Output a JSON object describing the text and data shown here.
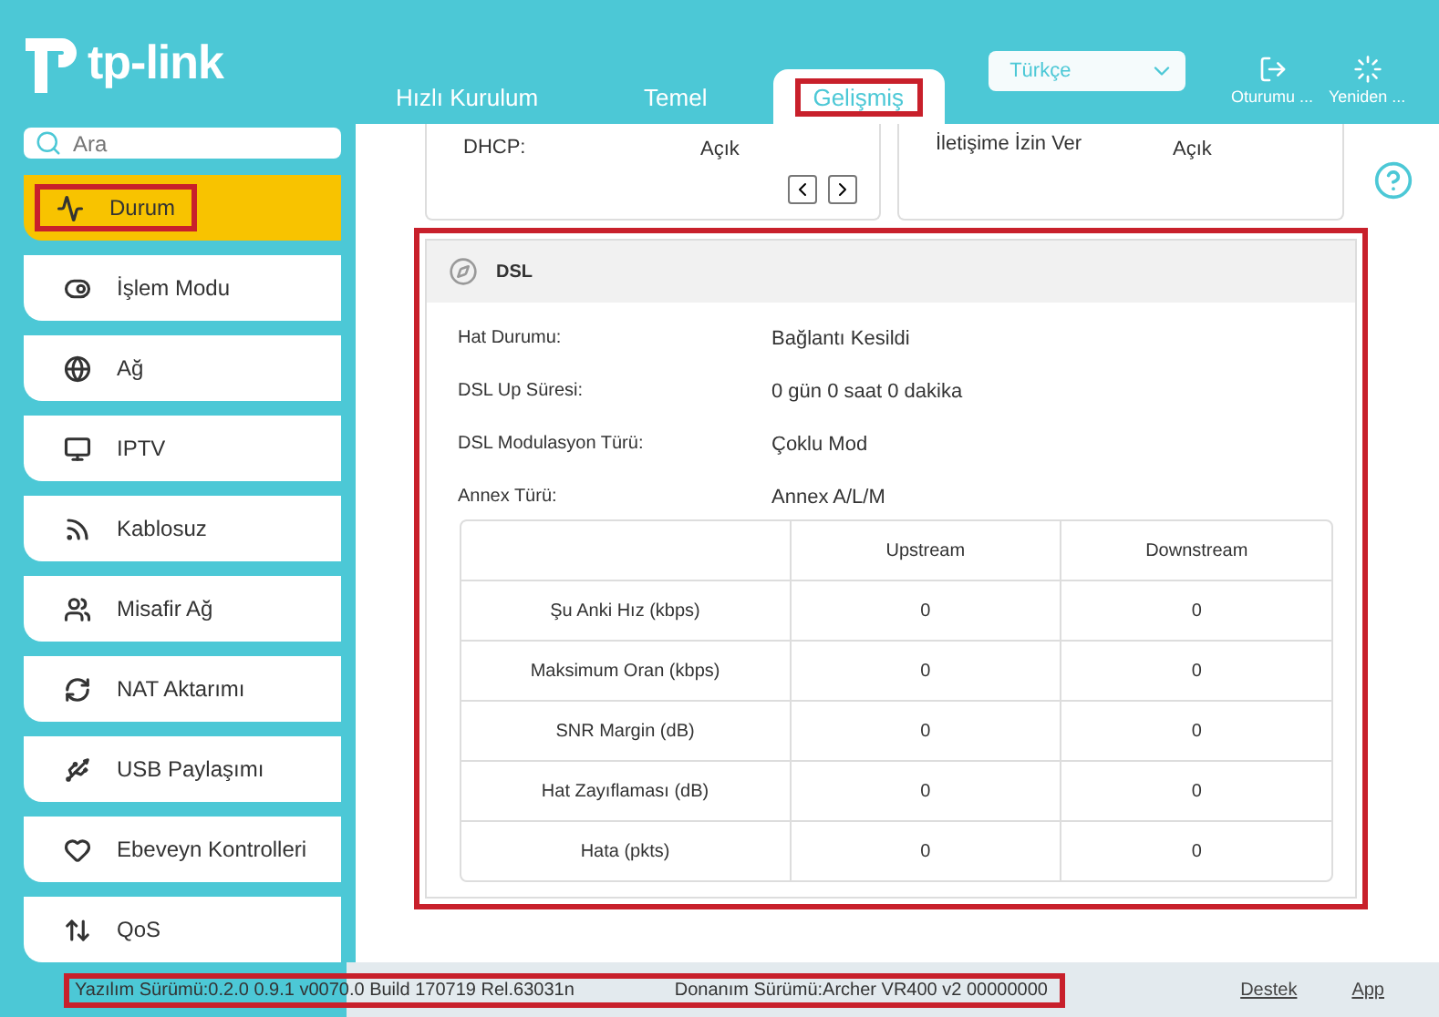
{
  "logo": {
    "text": "tp-link"
  },
  "tabs": [
    {
      "label": "Hızlı Kurulum",
      "selected": false,
      "highlighted": false
    },
    {
      "label": "Temel",
      "selected": false,
      "highlighted": false
    },
    {
      "label": "Gelişmiş",
      "selected": true,
      "highlighted": true
    }
  ],
  "language": {
    "value": "Türkçe"
  },
  "header_actions": [
    {
      "kind": "logout",
      "label": "Oturumu ..."
    },
    {
      "kind": "reboot",
      "label": "Yeniden ..."
    }
  ],
  "search": {
    "placeholder": "Ara"
  },
  "sidebar": {
    "items": [
      {
        "label": "Durum",
        "selected": true,
        "highlighted": true
      },
      {
        "label": "İşlem Modu",
        "selected": false,
        "highlighted": false
      },
      {
        "label": "Ağ",
        "selected": false,
        "highlighted": false
      },
      {
        "label": "IPTV",
        "selected": false,
        "highlighted": false
      },
      {
        "label": "Kablosuz",
        "selected": false,
        "highlighted": false
      },
      {
        "label": "Misafir Ağ",
        "selected": false,
        "highlighted": false
      },
      {
        "label": "NAT Aktarımı",
        "selected": false,
        "highlighted": false
      },
      {
        "label": "USB Paylaşımı",
        "selected": false,
        "highlighted": false
      },
      {
        "label": "Ebeveyn Kontrolleri",
        "selected": false,
        "highlighted": false
      },
      {
        "label": "QoS",
        "selected": false,
        "highlighted": false
      }
    ]
  },
  "top_cards": [
    {
      "label": "DHCP:",
      "value": "Açık",
      "pager": true
    },
    {
      "label": "İletişime İzin Ver",
      "value": "Açık",
      "pager": false
    }
  ],
  "dsl_panel": {
    "title": "DSL",
    "highlighted": true,
    "fields": [
      {
        "label": "Hat Durumu:",
        "value": "Bağlantı Kesildi"
      },
      {
        "label": "DSL Up Süresi:",
        "value": "0 gün 0 saat 0 dakika"
      },
      {
        "label": "DSL Modulasyon Türü:",
        "value": "Çoklu Mod"
      },
      {
        "label": "Annex Türü:",
        "value": "Annex A/L/M"
      }
    ],
    "table": {
      "columns": [
        "Upstream",
        "Downstream"
      ],
      "rows": [
        {
          "label": "Şu Anki Hız (kbps)",
          "upstream": "0",
          "downstream": "0"
        },
        {
          "label": "Maksimum Oran (kbps)",
          "upstream": "0",
          "downstream": "0"
        },
        {
          "label": "SNR Margin (dB)",
          "upstream": "0",
          "downstream": "0"
        },
        {
          "label": "Hat Zayıflaması (dB)",
          "upstream": "0",
          "downstream": "0"
        },
        {
          "label": "Hata (pkts)",
          "upstream": "0",
          "downstream": "0"
        }
      ]
    }
  },
  "status_bar": {
    "highlighted": true,
    "firmware": "Yazılım Sürümü:0.2.0 0.9.1 v0070.0 Build 170719 Rel.63031n",
    "hardware": "Donanım Sürümü:Archer VR400 v2 00000000",
    "links": [
      "Destek",
      "App"
    ]
  }
}
